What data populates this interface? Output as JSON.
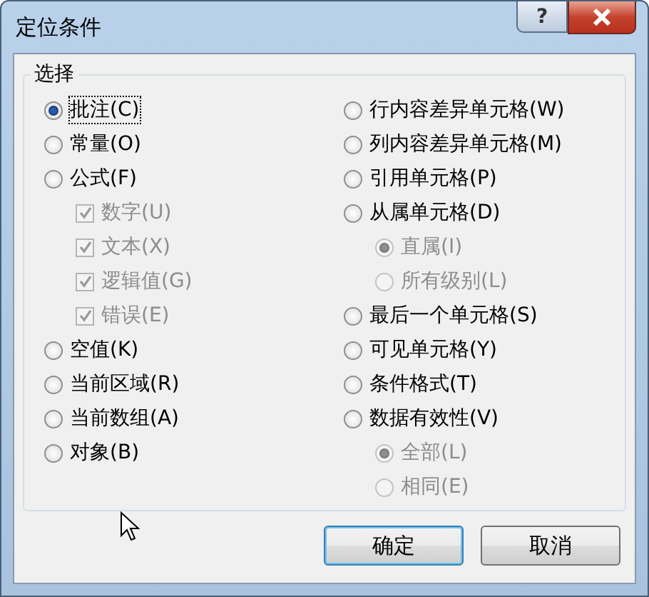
{
  "window": {
    "title": "定位条件",
    "help_label": "?"
  },
  "group": {
    "title": "选择",
    "left": [
      {
        "kind": "radio",
        "label": "批注(C)",
        "selected": true,
        "disabled": false
      },
      {
        "kind": "radio",
        "label": "常量(O)",
        "selected": false,
        "disabled": false
      },
      {
        "kind": "radio",
        "label": "公式(F)",
        "selected": false,
        "disabled": false,
        "children": [
          {
            "kind": "checkbox",
            "label": "数字(U)",
            "checked": true,
            "disabled": true
          },
          {
            "kind": "checkbox",
            "label": "文本(X)",
            "checked": true,
            "disabled": true
          },
          {
            "kind": "checkbox",
            "label": "逻辑值(G)",
            "checked": true,
            "disabled": true
          },
          {
            "kind": "checkbox",
            "label": "错误(E)",
            "checked": true,
            "disabled": true
          }
        ]
      },
      {
        "kind": "radio",
        "label": "空值(K)",
        "selected": false,
        "disabled": false
      },
      {
        "kind": "radio",
        "label": "当前区域(R)",
        "selected": false,
        "disabled": false
      },
      {
        "kind": "radio",
        "label": "当前数组(A)",
        "selected": false,
        "disabled": false
      },
      {
        "kind": "radio",
        "label": "对象(B)",
        "selected": false,
        "disabled": false
      }
    ],
    "right": [
      {
        "kind": "radio",
        "label": "行内容差异单元格(W)",
        "selected": false,
        "disabled": false
      },
      {
        "kind": "radio",
        "label": "列内容差异单元格(M)",
        "selected": false,
        "disabled": false
      },
      {
        "kind": "radio",
        "label": "引用单元格(P)",
        "selected": false,
        "disabled": false
      },
      {
        "kind": "radio",
        "label": "从属单元格(D)",
        "selected": false,
        "disabled": false,
        "children": [
          {
            "kind": "radio",
            "label": "直属(I)",
            "selected": true,
            "disabled": true
          },
          {
            "kind": "radio",
            "label": "所有级别(L)",
            "selected": false,
            "disabled": true
          }
        ]
      },
      {
        "kind": "radio",
        "label": "最后一个单元格(S)",
        "selected": false,
        "disabled": false
      },
      {
        "kind": "radio",
        "label": "可见单元格(Y)",
        "selected": false,
        "disabled": false
      },
      {
        "kind": "radio",
        "label": "条件格式(T)",
        "selected": false,
        "disabled": false
      },
      {
        "kind": "radio",
        "label": "数据有效性(V)",
        "selected": false,
        "disabled": false,
        "children": [
          {
            "kind": "radio",
            "label": "全部(L)",
            "selected": true,
            "disabled": true
          },
          {
            "kind": "radio",
            "label": "相同(E)",
            "selected": false,
            "disabled": true
          }
        ]
      }
    ]
  },
  "buttons": [
    {
      "label": "确定",
      "default": true
    },
    {
      "label": "取消",
      "default": false
    }
  ]
}
